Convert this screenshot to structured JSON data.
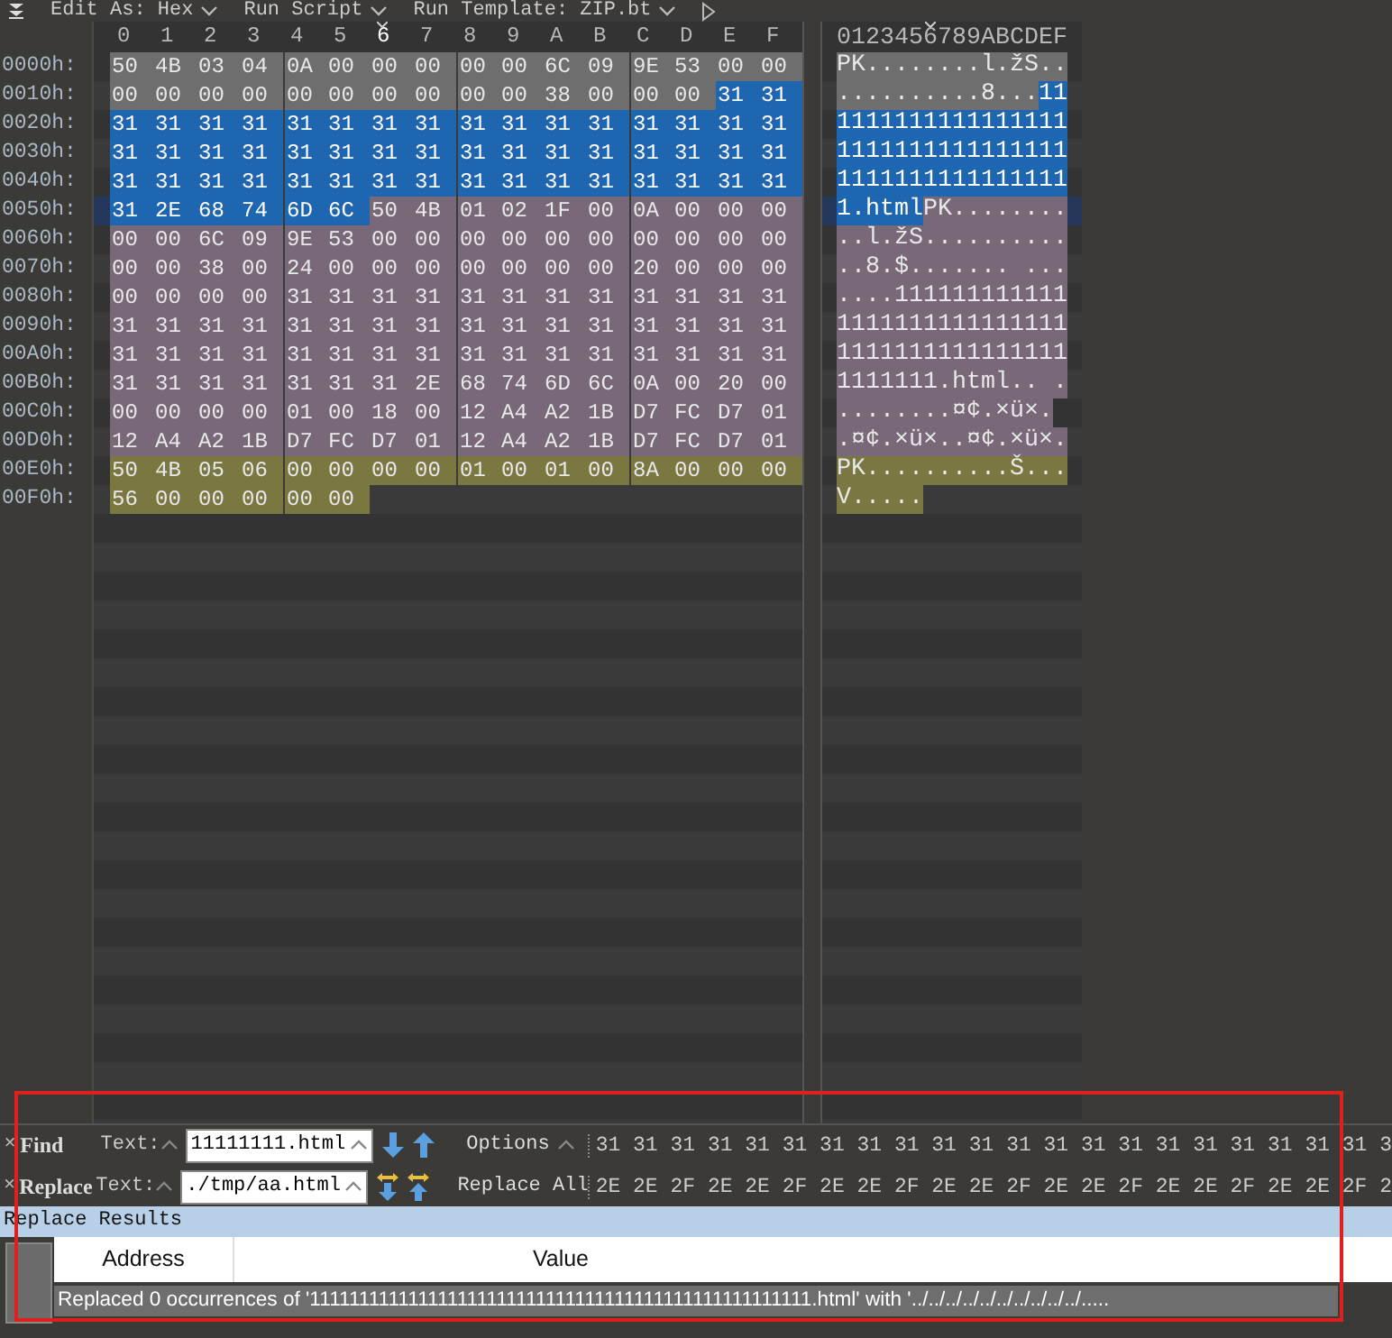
{
  "toolbar": {
    "items": [
      {
        "label": "Edit As: Hex"
      },
      {
        "label": "Run Script"
      },
      {
        "label": "Run Template: ZIP.bt"
      }
    ]
  },
  "hex_view": {
    "columns": [
      {
        "label": "0",
        "selected": false
      },
      {
        "label": "1",
        "selected": false
      },
      {
        "label": "2",
        "selected": false
      },
      {
        "label": "3",
        "selected": false
      },
      {
        "label": "4",
        "selected": false
      },
      {
        "label": "5",
        "selected": false
      },
      {
        "label": "6",
        "selected": true
      },
      {
        "label": "7",
        "selected": false
      },
      {
        "label": "8",
        "selected": false
      },
      {
        "label": "9",
        "selected": false
      },
      {
        "label": "A",
        "selected": false
      },
      {
        "label": "B",
        "selected": false
      },
      {
        "label": "C",
        "selected": false
      },
      {
        "label": "D",
        "selected": false
      },
      {
        "label": "E",
        "selected": false
      },
      {
        "label": "F",
        "selected": false
      }
    ],
    "ascii_header": "0123456789ABCDEF",
    "rows": [
      {
        "address": "0000h:",
        "current": false,
        "segments": [
          {
            "color": "#6e6e6e",
            "selected": false,
            "bytes": [
              "50",
              "4B",
              "03",
              "04",
              "0A",
              "00",
              "00",
              "00",
              "00",
              "00",
              "6C",
              "09",
              "9E",
              "53",
              "00",
              "00"
            ],
            "ascii": "PK........l.žS.."
          }
        ]
      },
      {
        "address": "0010h:",
        "current": false,
        "segments": [
          {
            "color": "#6e6e6e",
            "selected": false,
            "bytes": [
              "00",
              "00",
              "00",
              "00",
              "00",
              "00",
              "00",
              "00",
              "00",
              "00",
              "38",
              "00",
              "00",
              "00"
            ],
            "ascii": "..........8..."
          },
          {
            "color": "#1e66b0",
            "selected": true,
            "bytes": [
              "31",
              "31"
            ],
            "ascii": "11"
          }
        ]
      },
      {
        "address": "0020h:",
        "current": false,
        "segments": [
          {
            "color": "#1e66b0",
            "selected": true,
            "bytes": [
              "31",
              "31",
              "31",
              "31",
              "31",
              "31",
              "31",
              "31",
              "31",
              "31",
              "31",
              "31",
              "31",
              "31",
              "31",
              "31"
            ],
            "ascii": "1111111111111111"
          }
        ]
      },
      {
        "address": "0030h:",
        "current": false,
        "segments": [
          {
            "color": "#1e66b0",
            "selected": true,
            "bytes": [
              "31",
              "31",
              "31",
              "31",
              "31",
              "31",
              "31",
              "31",
              "31",
              "31",
              "31",
              "31",
              "31",
              "31",
              "31",
              "31"
            ],
            "ascii": "1111111111111111"
          }
        ]
      },
      {
        "address": "0040h:",
        "current": false,
        "segments": [
          {
            "color": "#1e66b0",
            "selected": true,
            "bytes": [
              "31",
              "31",
              "31",
              "31",
              "31",
              "31",
              "31",
              "31",
              "31",
              "31",
              "31",
              "31",
              "31",
              "31",
              "31",
              "31"
            ],
            "ascii": "1111111111111111"
          }
        ]
      },
      {
        "address": "0050h:",
        "current": true,
        "segments": [
          {
            "color": "#1e66b0",
            "selected": true,
            "bytes": [
              "31",
              "2E",
              "68",
              "74",
              "6D",
              "6C"
            ],
            "ascii": "1.html"
          },
          {
            "color": "#786878",
            "selected": false,
            "bytes": [
              "50",
              "4B",
              "01",
              "02",
              "1F",
              "00",
              "0A",
              "00",
              "00",
              "00"
            ],
            "ascii": "PK........"
          }
        ]
      },
      {
        "address": "0060h:",
        "current": false,
        "segments": [
          {
            "color": "#786878",
            "selected": false,
            "bytes": [
              "00",
              "00",
              "6C",
              "09",
              "9E",
              "53",
              "00",
              "00",
              "00",
              "00",
              "00",
              "00",
              "00",
              "00",
              "00",
              "00"
            ],
            "ascii": "..l.žS.........."
          }
        ]
      },
      {
        "address": "0070h:",
        "current": false,
        "segments": [
          {
            "color": "#786878",
            "selected": false,
            "bytes": [
              "00",
              "00",
              "38",
              "00",
              "24",
              "00",
              "00",
              "00",
              "00",
              "00",
              "00",
              "00",
              "20",
              "00",
              "00",
              "00"
            ],
            "ascii": "..8.$....... ..."
          }
        ]
      },
      {
        "address": "0080h:",
        "current": false,
        "segments": [
          {
            "color": "#786878",
            "selected": false,
            "bytes": [
              "00",
              "00",
              "00",
              "00",
              "31",
              "31",
              "31",
              "31",
              "31",
              "31",
              "31",
              "31",
              "31",
              "31",
              "31",
              "31"
            ],
            "ascii": "....111111111111"
          }
        ]
      },
      {
        "address": "0090h:",
        "current": false,
        "segments": [
          {
            "color": "#786878",
            "selected": false,
            "bytes": [
              "31",
              "31",
              "31",
              "31",
              "31",
              "31",
              "31",
              "31",
              "31",
              "31",
              "31",
              "31",
              "31",
              "31",
              "31",
              "31"
            ],
            "ascii": "1111111111111111"
          }
        ]
      },
      {
        "address": "00A0h:",
        "current": false,
        "segments": [
          {
            "color": "#786878",
            "selected": false,
            "bytes": [
              "31",
              "31",
              "31",
              "31",
              "31",
              "31",
              "31",
              "31",
              "31",
              "31",
              "31",
              "31",
              "31",
              "31",
              "31",
              "31"
            ],
            "ascii": "1111111111111111"
          }
        ]
      },
      {
        "address": "00B0h:",
        "current": false,
        "segments": [
          {
            "color": "#786878",
            "selected": false,
            "bytes": [
              "31",
              "31",
              "31",
              "31",
              "31",
              "31",
              "31",
              "2E",
              "68",
              "74",
              "6D",
              "6C",
              "0A",
              "00",
              "20",
              "00"
            ],
            "ascii": "1111111.html.. ."
          }
        ]
      },
      {
        "address": "00C0h:",
        "current": false,
        "segments": [
          {
            "color": "#786878",
            "selected": false,
            "bytes": [
              "00",
              "00",
              "00",
              "00",
              "01",
              "00",
              "18",
              "00",
              "12",
              "A4",
              "A2",
              "1B",
              "D7",
              "FC",
              "D7",
              "01"
            ],
            "ascii": "........¤¢.×ü×."
          }
        ]
      },
      {
        "address": "00D0h:",
        "current": false,
        "segments": [
          {
            "color": "#786878",
            "selected": false,
            "bytes": [
              "12",
              "A4",
              "A2",
              "1B",
              "D7",
              "FC",
              "D7",
              "01",
              "12",
              "A4",
              "A2",
              "1B",
              "D7",
              "FC",
              "D7",
              "01"
            ],
            "ascii": ".¤¢.×ü×..¤¢.×ü×."
          }
        ]
      },
      {
        "address": "00E0h:",
        "current": false,
        "segments": [
          {
            "color": "#7a7840",
            "selected": false,
            "bytes": [
              "50",
              "4B",
              "05",
              "06",
              "00",
              "00",
              "00",
              "00",
              "01",
              "00",
              "01",
              "00",
              "8A",
              "00",
              "00",
              "00"
            ],
            "ascii": "PK..........Š..."
          }
        ]
      },
      {
        "address": "00F0h:",
        "current": false,
        "segments": [
          {
            "color": "#7a7840",
            "selected": false,
            "bytes": [
              "56",
              "00",
              "00",
              "00",
              "00",
              "00"
            ],
            "ascii": "V....."
          }
        ]
      }
    ]
  },
  "find_panel": {
    "rows": [
      {
        "kind": "find",
        "close": "×",
        "title": "Find",
        "text_label": "Text:",
        "value": "11111111.html",
        "action": "Options",
        "hex_preview": "31 31 31 31 31 31 31 31 31 31 31 31 31 31 31 31 31 31 31 31 31 3"
      },
      {
        "kind": "replace",
        "close": "×",
        "title": "Replace",
        "text_label": "Text:",
        "value": "./tmp/aa.html",
        "action": "Replace All",
        "hex_preview": "2E 2E 2F 2E 2E 2F 2E 2E 2F 2E 2E 2F 2E 2E 2F 2E 2E 2F 2E 2E 2F 2"
      }
    ]
  },
  "results": {
    "title": "Replace Results",
    "columns": [
      "Address",
      "Value"
    ],
    "message": "Replaced 0 occurrences of '111111111111111111111111111111111111111111111111111.html' with '../../../../../../../../../../....."
  },
  "annotation_box": true
}
